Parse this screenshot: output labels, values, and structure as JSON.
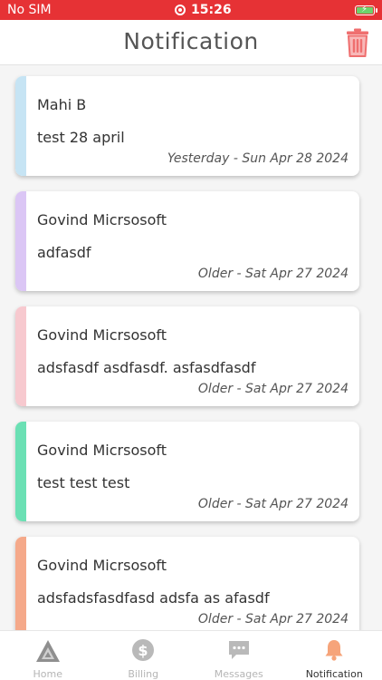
{
  "status_bar": {
    "carrier": "No SIM",
    "time": "15:26"
  },
  "header": {
    "title": "Notification"
  },
  "notifications": [
    {
      "sender": "Mahi B",
      "message": "test 28 april",
      "date": "Yesterday - Sun Apr 28 2024",
      "accent": "#c6e4f4"
    },
    {
      "sender": "Govind Micrsosoft",
      "message": "adfasdf",
      "date": "Older - Sat Apr 27 2024",
      "accent": "#dbc6f5"
    },
    {
      "sender": "Govind Micrsosoft",
      "message": "adsfasdf asdfasdf. asfasdfasdf",
      "date": "Older - Sat Apr 27 2024",
      "accent": "#f7c9cf"
    },
    {
      "sender": "Govind Micrsosoft",
      "message": "test test test",
      "date": "Older - Sat Apr 27 2024",
      "accent": "#6be0b4"
    },
    {
      "sender": "Govind Micrsosoft",
      "message": "adsfadsfasdfasd adsfa as afasdf",
      "date": "Older - Sat Apr 27 2024",
      "accent": "#f5a98a"
    }
  ],
  "bottom_nav": {
    "items": [
      {
        "label": "Home",
        "icon": "triangle-logo-icon",
        "active": false
      },
      {
        "label": "Billing",
        "icon": "dollar-icon",
        "active": false
      },
      {
        "label": "Messages",
        "icon": "chat-icon",
        "active": false
      },
      {
        "label": "Notification",
        "icon": "bell-icon",
        "active": true
      }
    ]
  },
  "colors": {
    "status_bar": "#e63235",
    "trash": "#ef6f6f",
    "bell_active": "#f6a47a"
  }
}
